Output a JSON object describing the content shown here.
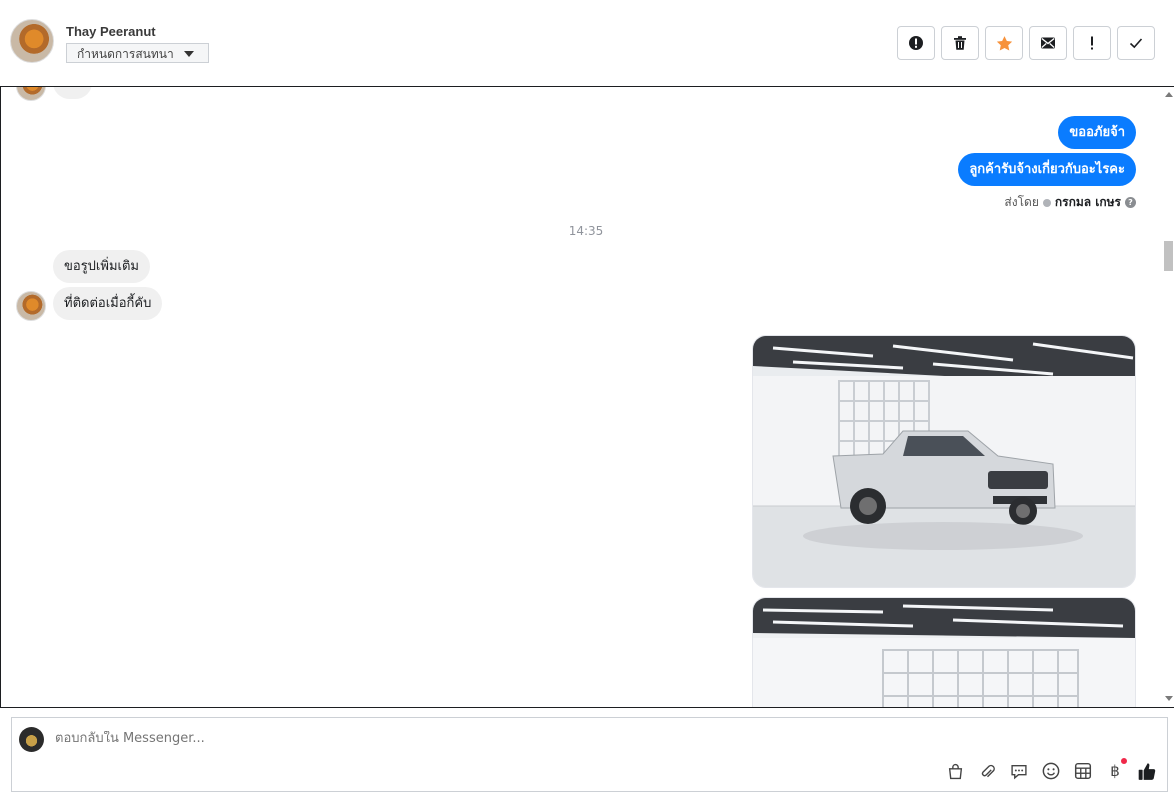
{
  "header": {
    "contact_name": "Thay Peeranut",
    "label_dropdown": "กำหนดการสนทนา",
    "actions": [
      {
        "name": "report-spam-button",
        "icon": "alert-circle-icon"
      },
      {
        "name": "delete-button",
        "icon": "trash-icon"
      },
      {
        "name": "star-button",
        "icon": "star-icon"
      },
      {
        "name": "mark-unread-button",
        "icon": "envelope-icon"
      },
      {
        "name": "follow-up-button",
        "icon": "exclamation-icon"
      },
      {
        "name": "mark-done-button",
        "icon": "check-icon"
      }
    ],
    "colors": {
      "star": "#f7923b"
    }
  },
  "thread": {
    "partial_top_text": "คับ",
    "outgoing": [
      "ขออภัยจ้า",
      "ลูกค้ารับจ้างเกี่ยวกับอะไรคะ"
    ],
    "sent_by_label": "ส่งโดย",
    "sent_by_agent": "กรกมล เกษร",
    "timestamp": "14:35",
    "incoming": [
      "ขอรูปเพิ่มเติม",
      "ที่ติดต่อเมื่อกี้คับ"
    ],
    "colors": {
      "outgoing_bubble": "#0a7cff",
      "incoming_bubble": "#f0f0f0"
    }
  },
  "composer": {
    "placeholder": "ตอบกลับใน Messenger...",
    "tools": [
      "bag-icon",
      "paperclip-icon",
      "saved-reply-icon",
      "emoji-icon",
      "table-icon",
      "baht-icon",
      "thumbs-up-icon"
    ],
    "baht_symbol": "฿"
  }
}
